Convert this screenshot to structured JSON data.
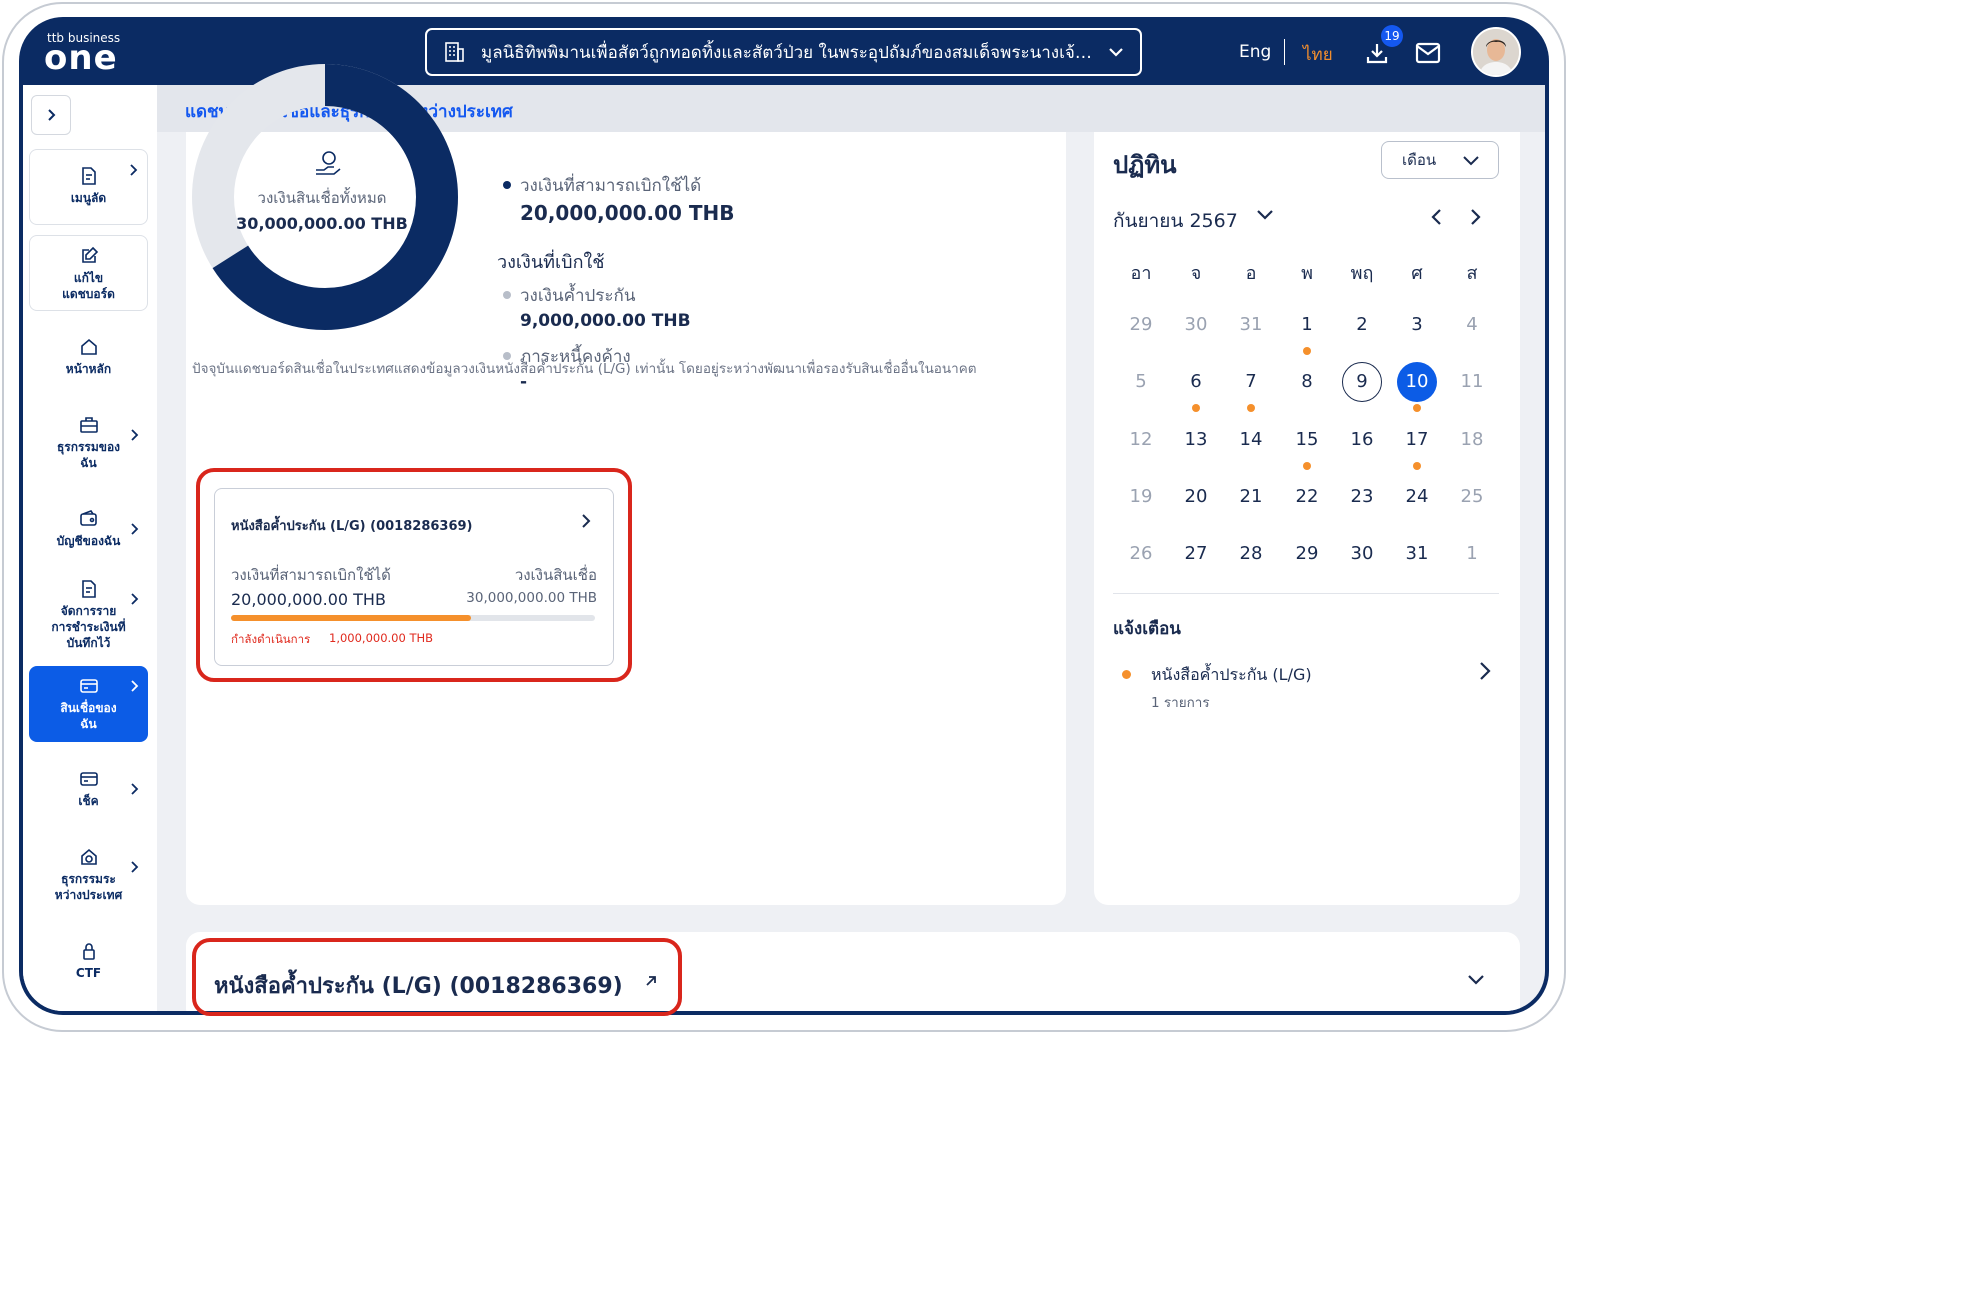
{
  "topbar": {
    "logo_small": "ttb business",
    "logo_big": "one",
    "org_name": "มูลนิธิทิพพิมานเพื่อสัตว์ถูกทอดทิ้งและสัตว์ป่วย ในพระอุปถัมภ์ของสมเด็จพระนางเจ้า...",
    "lang_en": "Eng",
    "lang_th": "ไทย",
    "download_badge": "19",
    "accent_color": "#f08d2e",
    "brand_color": "#0b2b63"
  },
  "sidebar": {
    "items": [
      {
        "label": "เมนูลัด",
        "icon": "shortcut-doc-icon"
      },
      {
        "label": "แก้ไข\nแดชบอร์ด",
        "icon": "edit-icon"
      },
      {
        "label": "หน้าหลัก",
        "icon": "home-icon"
      },
      {
        "label": "ธุรกรรมของ\nฉัน",
        "icon": "briefcase-icon"
      },
      {
        "label": "บัญชีของฉัน",
        "icon": "wallet-icon"
      },
      {
        "label": "จัดการราย\nการชำระเงินที่\nบันทึกไว้",
        "icon": "payment-doc-icon"
      },
      {
        "label": "สินเชื่อของ\nฉัน",
        "icon": "card-icon"
      },
      {
        "label": "เช็ค",
        "icon": "cheque-icon"
      },
      {
        "label": "ธุรกรรมระ\nหว่างประเทศ",
        "icon": "global-house-icon"
      },
      {
        "label": "CTF",
        "icon": "lock-icon"
      }
    ]
  },
  "header": {
    "title": "แดชบอร์ดสินเชื่อและธุรกรรมระหว่างประเทศ"
  },
  "summary": {
    "donut_label": "วงเงินสินเชื่อทั้งหมด",
    "donut_value": "30,000,000.00 THB",
    "donut_used_fraction": 0.34,
    "available_label": "วงเงินที่สามารถเบิกใช้ได้",
    "available_value": "20,000,000.00 THB",
    "used_title": "วงเงินที่เบิกใช้",
    "guarantee_label": "วงเงินค้ำประกัน",
    "guarantee_value": "9,000,000.00 THB",
    "outstanding_label": "ภาระหนี้คงค้าง",
    "outstanding_value": "-",
    "note": "ปัจจุบันแดชบอร์ดสินเชื่อในประเทศแสดงข้อมูลวงเงินหนังสือค้ำประกัน (L/G) เท่านั้น โดยอยู่ระหว่างพัฒนาเพื่อรองรับสินเชื่ออื่นในอนาคต"
  },
  "lg_card": {
    "title": "หนังสือค้ำประกัน (L/G) (0018286369)",
    "available_label": "วงเงินที่สามารถเบิกใช้ได้",
    "available_value": "20,000,000.00 THB",
    "credit_label": "วงเงินสินเชื่อ",
    "credit_value": "30,000,000.00 THB",
    "progress_fraction": 0.66,
    "processing_label": "กำลังดำเนินการ",
    "processing_value": "1,000,000.00 THB"
  },
  "calendar": {
    "title": "ปฏิทิน",
    "view_select": "เดือน",
    "month_year": "กันยายน 2567",
    "weekdays": [
      "อา",
      "จ",
      "อ",
      "พ",
      "พฤ",
      "ศ",
      "ส"
    ],
    "weeks": [
      [
        "29",
        "30",
        "31",
        "1",
        "2",
        "3",
        "4"
      ],
      [
        "5",
        "6",
        "7",
        "8",
        "9",
        "10",
        "11"
      ],
      [
        "12",
        "13",
        "14",
        "15",
        "16",
        "17",
        "18"
      ],
      [
        "19",
        "20",
        "21",
        "22",
        "23",
        "24",
        "25"
      ],
      [
        "26",
        "27",
        "28",
        "29",
        "30",
        "31",
        "1"
      ]
    ]
  },
  "alerts": {
    "title": "แจ้งเตือน",
    "item_title": "หนังสือค้ำประกัน (L/G)",
    "item_sub": "1 รายการ"
  },
  "bottom_panel": {
    "title": "หนังสือค้ำประกัน (L/G) (0018286369)"
  }
}
